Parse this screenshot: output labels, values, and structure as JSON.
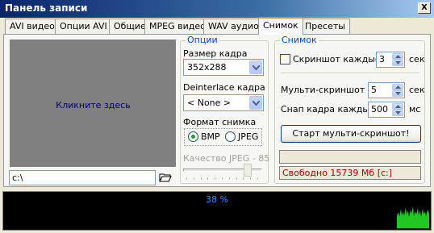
{
  "window": {
    "title": "Панель записи",
    "close_label": "X"
  },
  "tabs": [
    {
      "label": "AVI видео"
    },
    {
      "label": "Опции AVI"
    },
    {
      "label": "Общие"
    },
    {
      "label": "MPEG видео"
    },
    {
      "label": "WAV аудио"
    },
    {
      "label": "Снимок",
      "active": true
    },
    {
      "label": "Пресеты"
    }
  ],
  "preview": {
    "text": "Кликните здесь"
  },
  "path": {
    "value": "c:\\"
  },
  "options": {
    "legend": "Опции",
    "frame_size_label": "Размер кадра",
    "frame_size_value": "352x288",
    "deinterlace_label": "Deinterlace кадра",
    "deinterlace_value": "< None >",
    "format_label": "Формат снимка",
    "format_options": [
      "BMP",
      "JPEG"
    ],
    "format_selected": "BMP",
    "jpeg_quality_label": "Качество JPEG - 85",
    "jpeg_quality": 85
  },
  "snapshot": {
    "legend": "Снимок",
    "screenshot_every_label": "Скриншот каждые",
    "screenshot_every_checked": false,
    "screenshot_every_value": "3",
    "screenshot_every_unit": "сек",
    "multi_label": "Мульти-скриншот",
    "multi_value": "5",
    "multi_unit": "сек",
    "snap_every_label": "Снап кадра каждые",
    "snap_every_value": "500",
    "snap_every_unit": "мс",
    "start_button": "Старт мульти-скриншот!",
    "status": "Свободно 15739 Мб [c:]"
  },
  "monitor": {
    "percent_text": "38 %",
    "level": 0.38
  },
  "colors": {
    "accent": "#0046d5",
    "status": "#a00000",
    "meter": "#21c821"
  }
}
